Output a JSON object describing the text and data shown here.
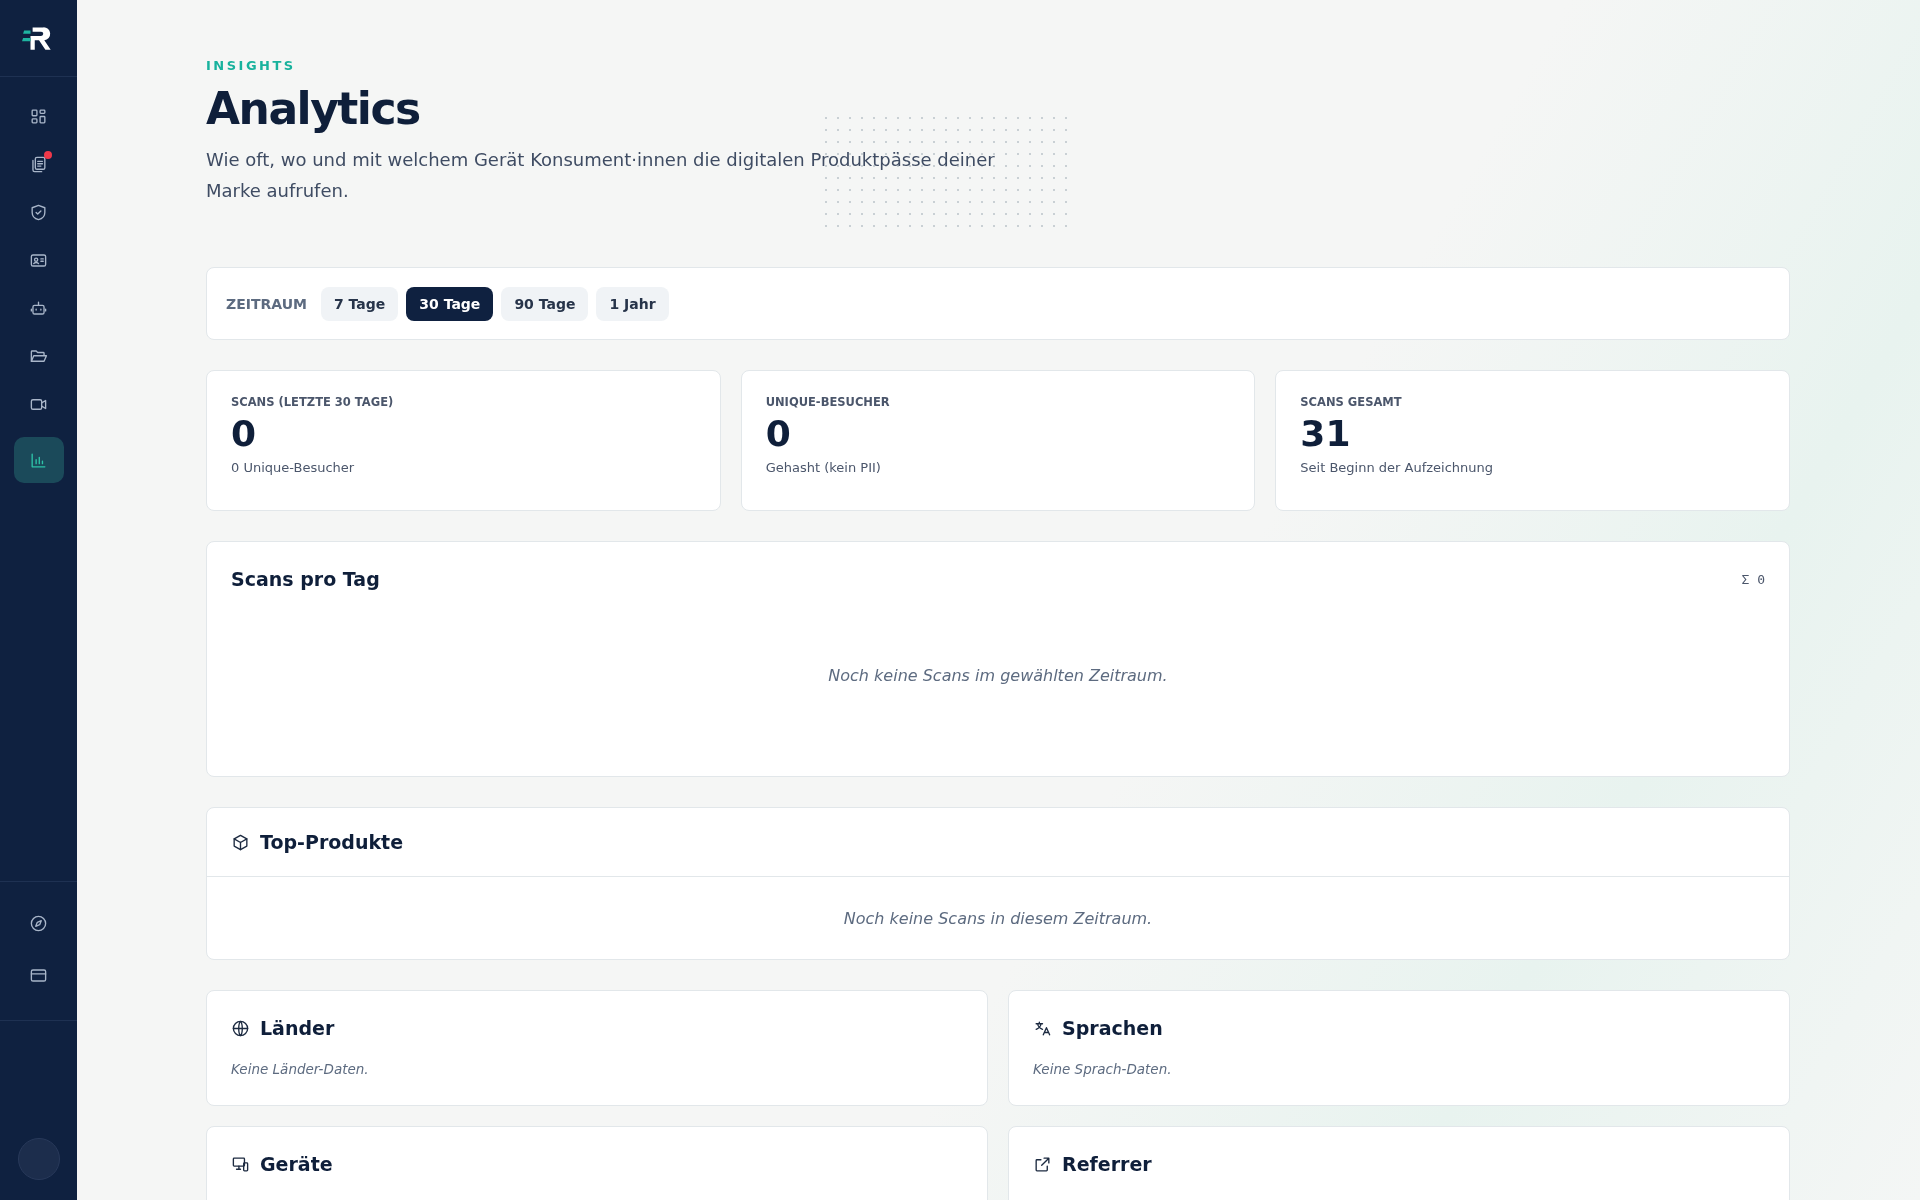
{
  "sidebar": {
    "items": [
      {
        "kind": "dashboard",
        "selected": false,
        "badge": false
      },
      {
        "kind": "documents",
        "selected": false,
        "badge": true
      },
      {
        "kind": "shield",
        "selected": false,
        "badge": false
      },
      {
        "kind": "id-card",
        "selected": false,
        "badge": false
      },
      {
        "kind": "robot",
        "selected": false,
        "badge": false
      },
      {
        "kind": "folder",
        "selected": false,
        "badge": false
      },
      {
        "kind": "video",
        "selected": false,
        "badge": false
      },
      {
        "kind": "chart",
        "selected": true,
        "badge": false
      }
    ],
    "bottom_items": [
      {
        "kind": "compass",
        "selected": false
      },
      {
        "kind": "card",
        "selected": false
      }
    ]
  },
  "header": {
    "eyebrow": "INSIGHTS",
    "title": "Analytics",
    "description": "Wie oft, wo und mit welchem Gerät Konsument·innen die digitalen Produktpässe deiner Marke aufrufen."
  },
  "period": {
    "label": "ZEITRAUM",
    "options": [
      {
        "label": "7 Tage",
        "selected": false
      },
      {
        "label": "30 Tage",
        "selected": true
      },
      {
        "label": "90 Tage",
        "selected": false
      },
      {
        "label": "1 Jahr",
        "selected": false
      }
    ]
  },
  "stats": [
    {
      "label": "SCANS (LETZTE 30 TAGE)",
      "value": "0",
      "note": "0 Unique-Besucher"
    },
    {
      "label": "UNIQUE-BESUCHER",
      "value": "0",
      "note": "Gehasht (kein PII)"
    },
    {
      "label": "SCANS GESAMT",
      "value": "31",
      "note": "Seit Beginn der Aufzeichnung"
    }
  ],
  "scans_per_day": {
    "title": "Scans pro Tag",
    "total": "Σ 0",
    "empty": "Noch keine Scans im gewählten Zeitraum."
  },
  "top_products": {
    "title": "Top-Produkte",
    "empty": "Noch keine Scans in diesem Zeitraum."
  },
  "panels": [
    {
      "kind": "globe",
      "title": "Länder",
      "empty": "Keine Länder-Daten."
    },
    {
      "kind": "translate",
      "title": "Sprachen",
      "empty": "Keine Sprach-Daten."
    },
    {
      "kind": "devices",
      "title": "Geräte"
    },
    {
      "kind": "external",
      "title": "Referrer"
    }
  ]
}
